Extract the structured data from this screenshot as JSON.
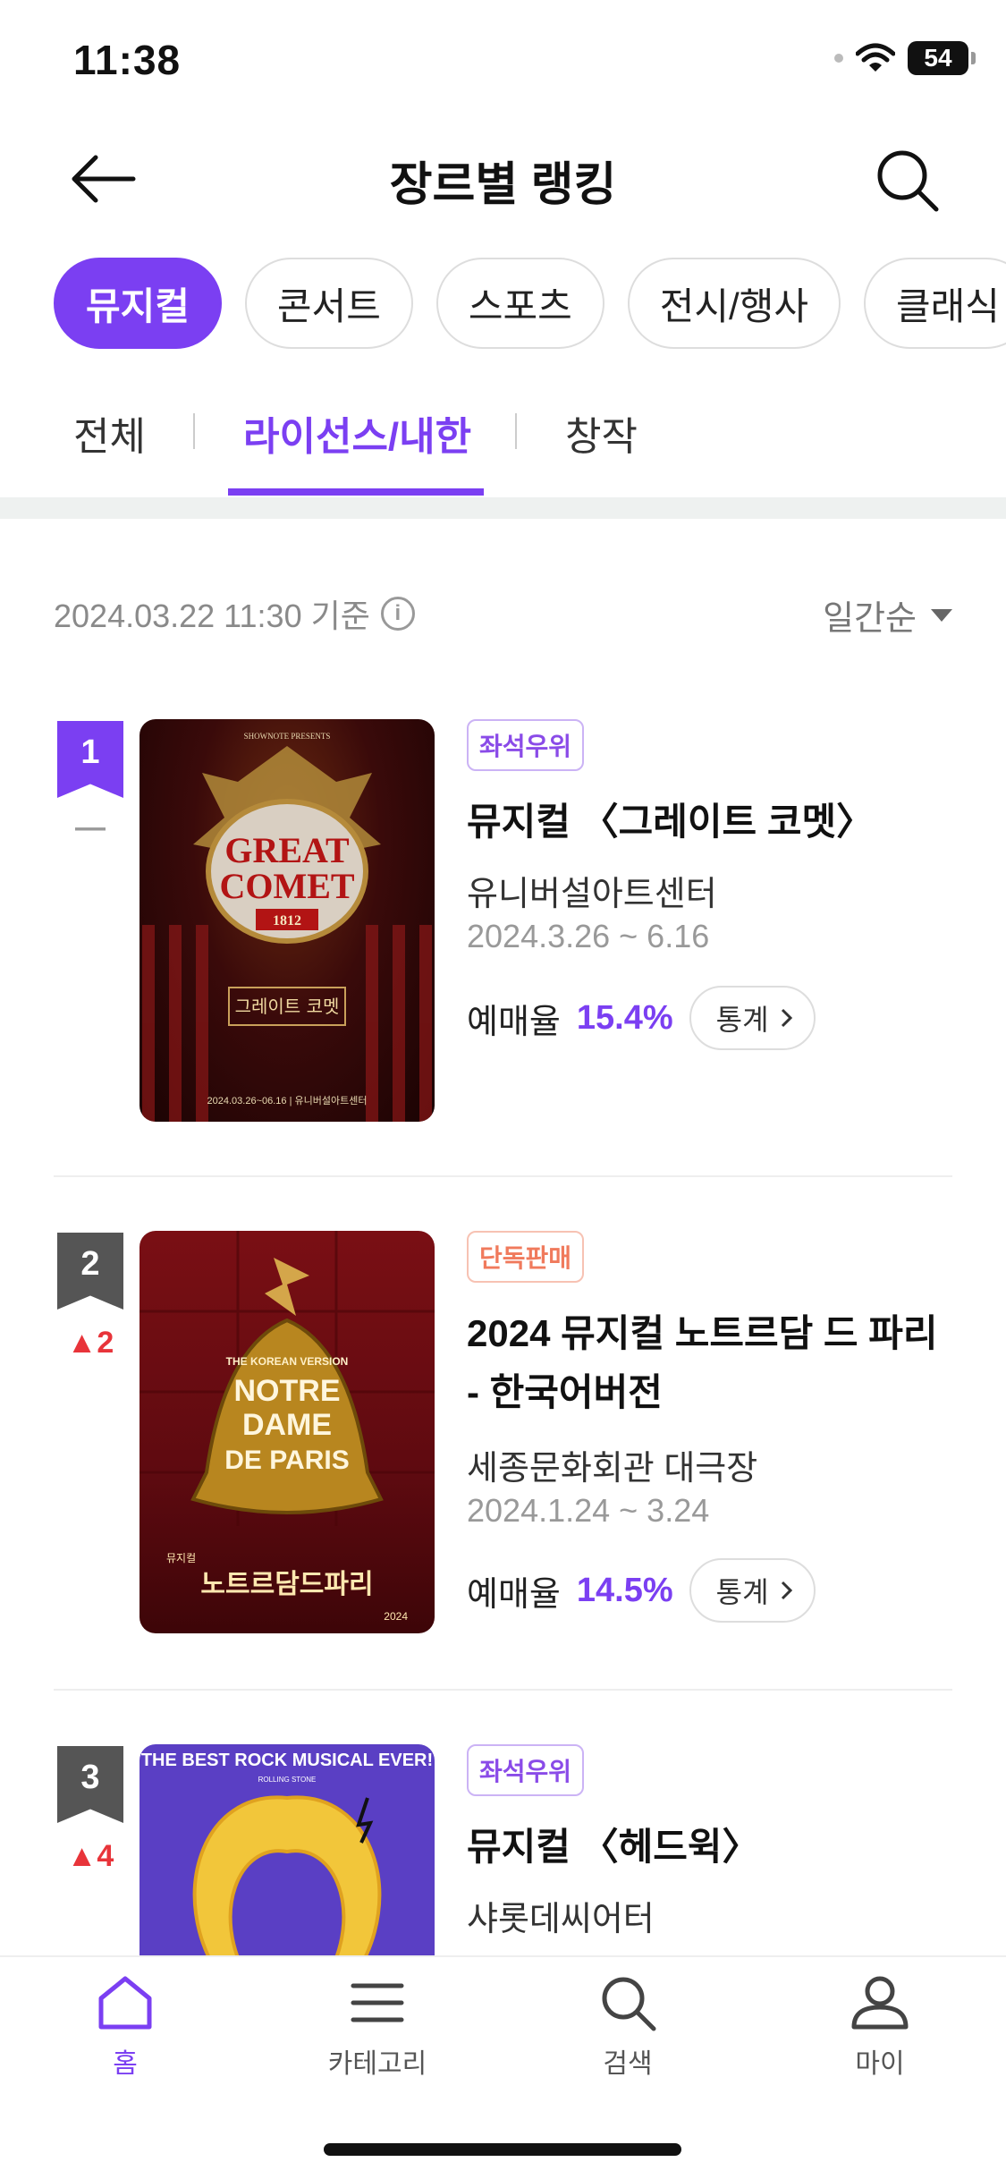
{
  "status_bar": {
    "time": "11:38",
    "battery": "54"
  },
  "header": {
    "title": "장르별 랭킹"
  },
  "genre_chips": [
    {
      "label": "뮤지컬",
      "active": true
    },
    {
      "label": "콘서트",
      "active": false
    },
    {
      "label": "스포츠",
      "active": false
    },
    {
      "label": "전시/행사",
      "active": false
    },
    {
      "label": "클래식",
      "active": false
    }
  ],
  "sub_tabs": [
    {
      "label": "전체",
      "active": false
    },
    {
      "label": "라이선스/내한",
      "active": true
    },
    {
      "label": "창작",
      "active": false
    }
  ],
  "basis": {
    "date_text": "2024.03.22 11:30 기준",
    "sort_label": "일간순"
  },
  "rankings": [
    {
      "rank": "1",
      "change": "—",
      "badge": "좌석우위",
      "title": "뮤지컬 〈그레이트 코멧〉",
      "venue": "유니버설아트센터",
      "period": "2024.3.26 ~ 6.16",
      "sales_label": "예매율",
      "sales_rate": "15.4%",
      "stat_label": "통계",
      "poster": {
        "top": "SHOWNOTE PRESENTS",
        "line1": "GREAT",
        "line2": "COMET",
        "year": "1812",
        "kr": "그레이트 코멧",
        "dates": "2024.03.26~06.16 | 유니버설아트센터"
      }
    },
    {
      "rank": "2",
      "change": "▲2",
      "badge": "단독판매",
      "title": "2024 뮤지컬 노트르담 드 파리 - 한국어버전",
      "venue": "세종문화회관 대극장",
      "period": "2024.1.24 ~ 3.24",
      "sales_label": "예매율",
      "sales_rate": "14.5%",
      "stat_label": "통계",
      "poster": {
        "top": "THE KOREAN VERSION",
        "line1": "NOTRE",
        "line2": "DAME",
        "line3": "DE PARIS",
        "kr_small": "뮤지컬",
        "kr": "노트르담드파리",
        "year": "2024"
      }
    },
    {
      "rank": "3",
      "change": "▲4",
      "badge": "좌석우위",
      "title": "뮤지컬 〈헤드윅〉",
      "venue": "샤롯데씨어터",
      "poster": {
        "top": "THE BEST ROCK MUSICAL EVER!",
        "sub": "ROLLING STONE"
      }
    }
  ],
  "bottom_nav": [
    {
      "label": "홈",
      "icon": "home-icon",
      "active": true
    },
    {
      "label": "카테고리",
      "icon": "menu-icon",
      "active": false
    },
    {
      "label": "검색",
      "icon": "search-icon",
      "active": false
    },
    {
      "label": "마이",
      "icon": "user-icon",
      "active": false
    }
  ],
  "colors": {
    "accent": "#7b3ff2",
    "rank_up": "#e8343a",
    "badge_exclusive": "#f07a5c",
    "rank_top": "#7b3ff2",
    "rank_other": "#555555"
  }
}
